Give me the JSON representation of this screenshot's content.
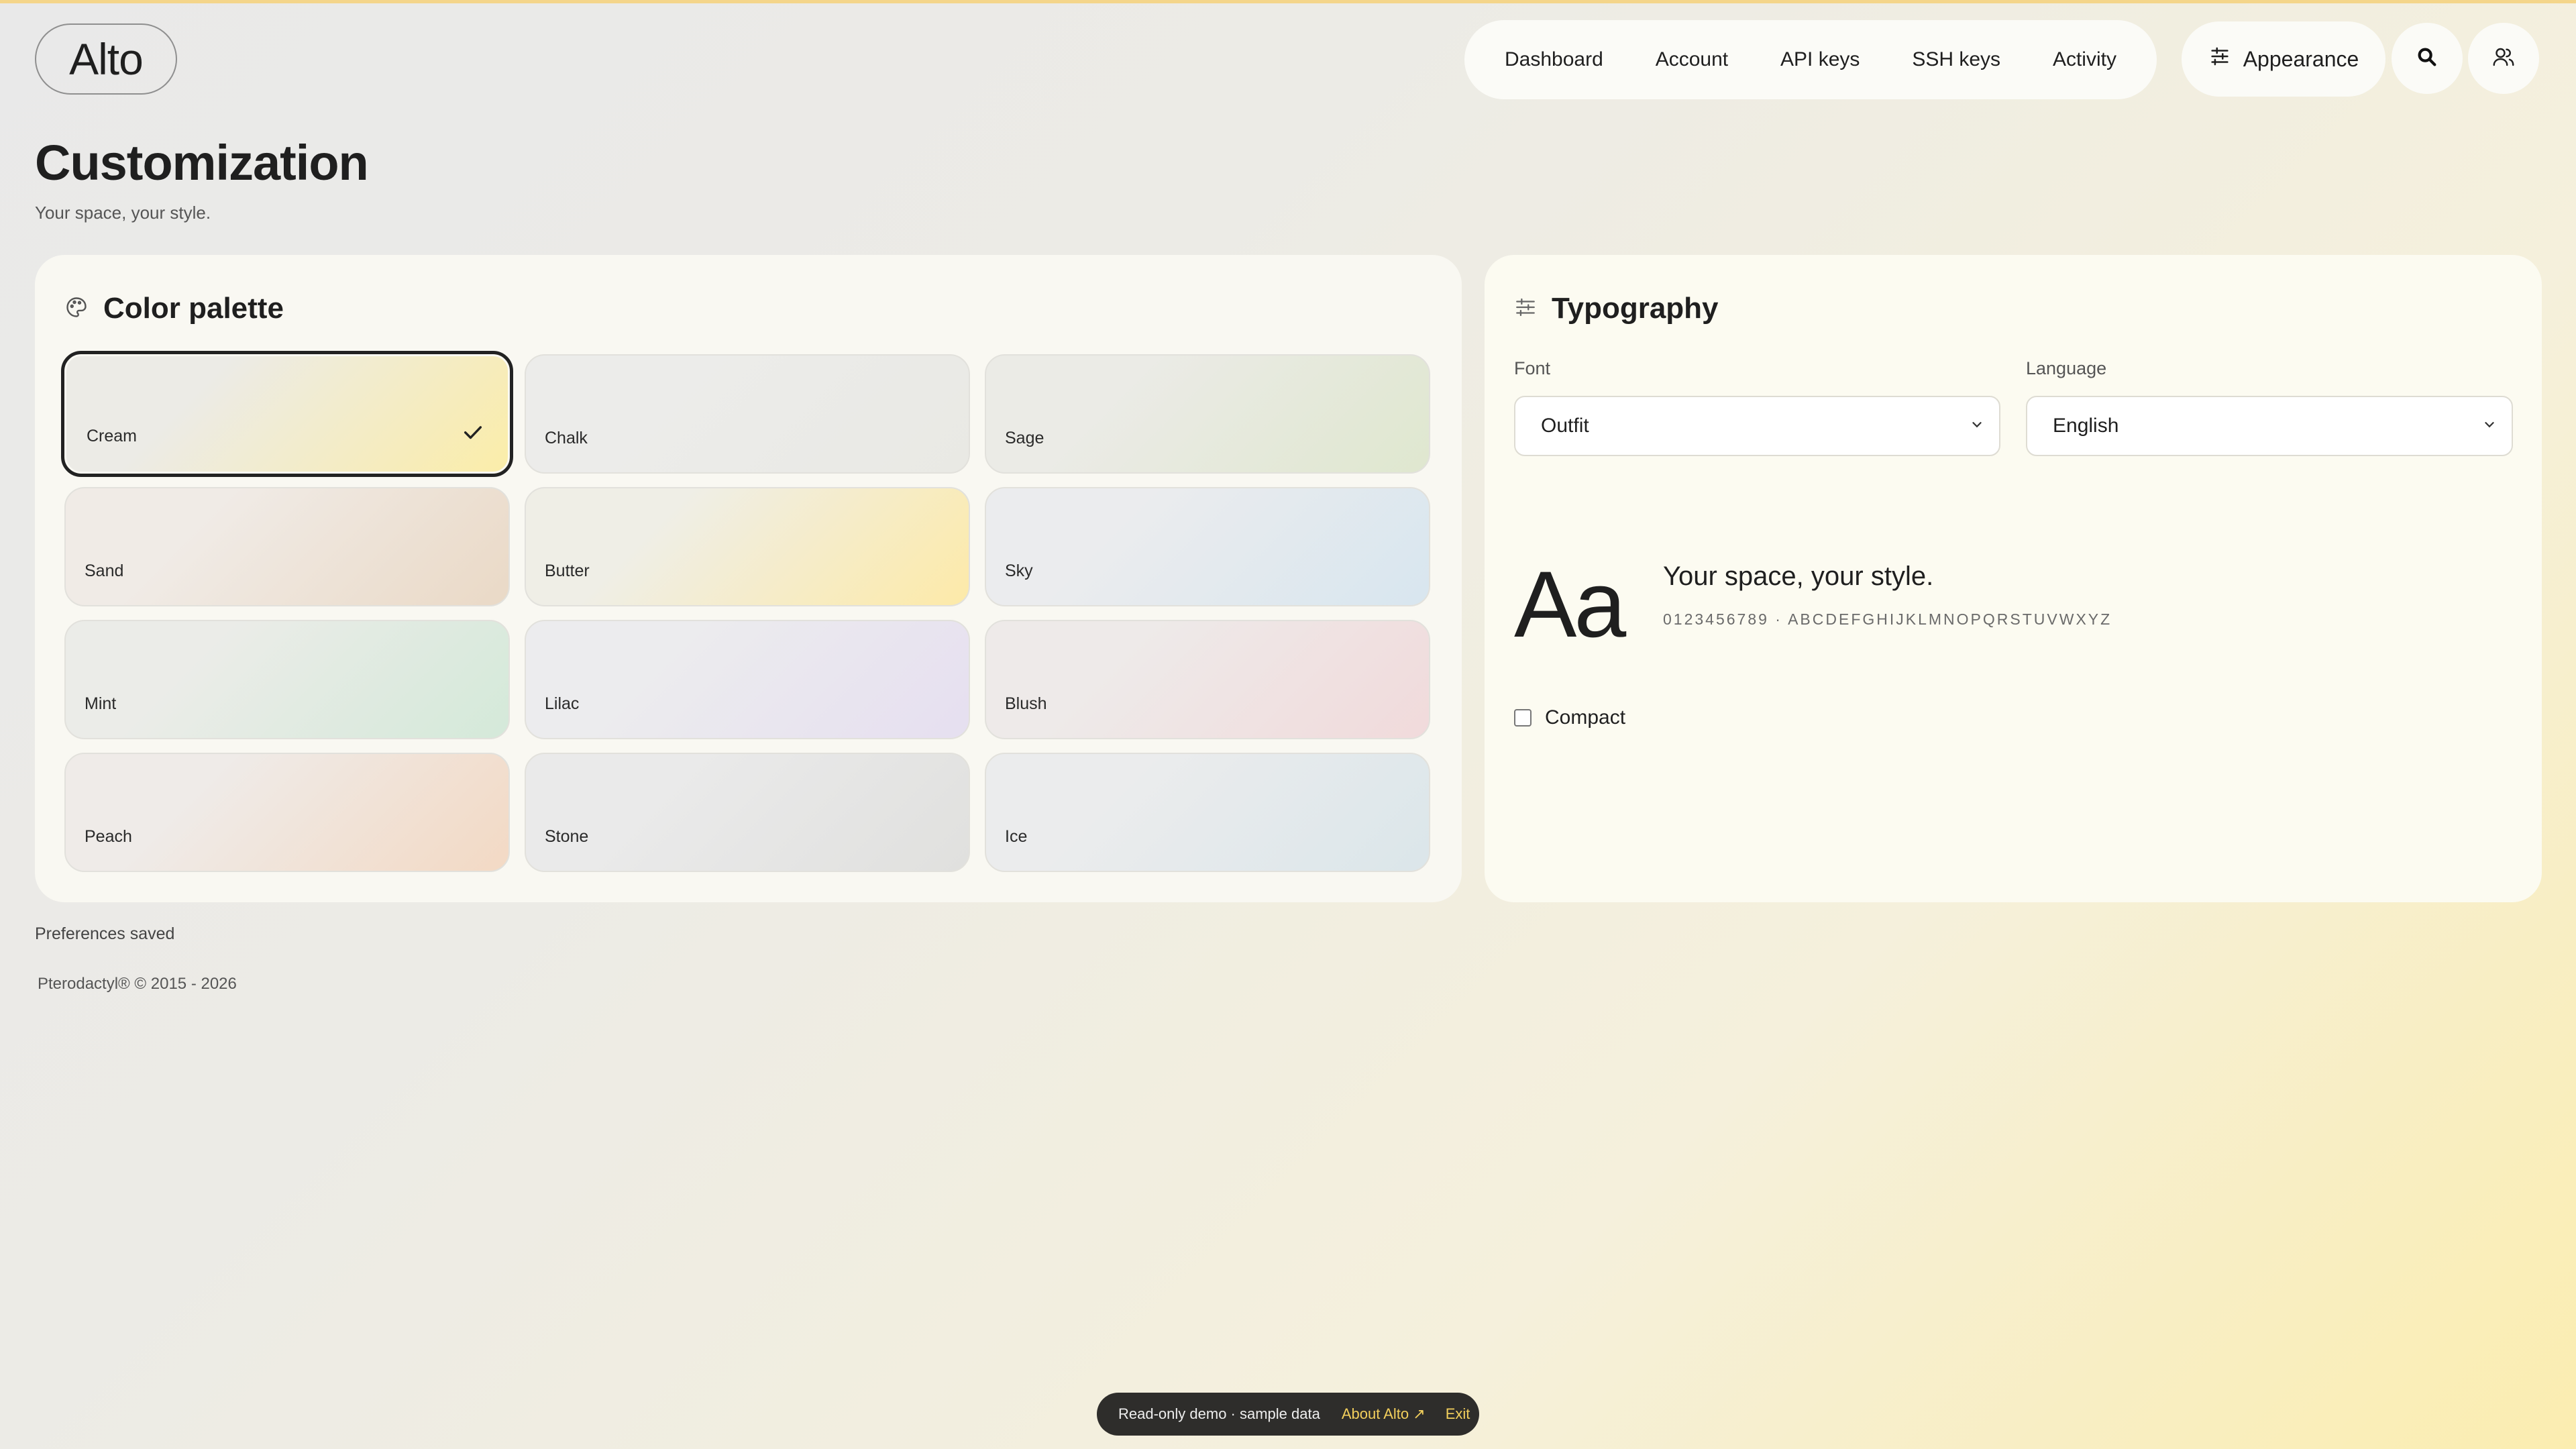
{
  "app": {
    "logo": "Alto"
  },
  "nav": {
    "items": [
      "Dashboard",
      "Account",
      "API keys",
      "SSH keys",
      "Activity"
    ],
    "appearance_label": "Appearance"
  },
  "page": {
    "title": "Customization",
    "subtitle": "Your space, your style."
  },
  "palette": {
    "title": "Color palette",
    "swatches": [
      {
        "label": "Cream",
        "selected": true,
        "from": "#ecebe6",
        "to": "#fbeda8"
      },
      {
        "label": "Chalk",
        "selected": false,
        "from": "#ececea",
        "to": "#e9e9e4"
      },
      {
        "label": "Sage",
        "selected": false,
        "from": "#ebebe6",
        "to": "#dfe7cf"
      },
      {
        "label": "Sand",
        "selected": false,
        "from": "#f0ebe6",
        "to": "#ead9c6"
      },
      {
        "label": "Butter",
        "selected": false,
        "from": "#efeee6",
        "to": "#fdeaa8"
      },
      {
        "label": "Sky",
        "selected": false,
        "from": "#ebecee",
        "to": "#d8e6ef"
      },
      {
        "label": "Mint",
        "selected": false,
        "from": "#ebece8",
        "to": "#d4e9d9"
      },
      {
        "label": "Lilac",
        "selected": false,
        "from": "#ececee",
        "to": "#e6dff0"
      },
      {
        "label": "Blush",
        "selected": false,
        "from": "#eeeae9",
        "to": "#f1dadb"
      },
      {
        "label": "Peach",
        "selected": false,
        "from": "#efebe8",
        "to": "#f3d9c4"
      },
      {
        "label": "Stone",
        "selected": false,
        "from": "#eaeaea",
        "to": "#e0e0de"
      },
      {
        "label": "Ice",
        "selected": false,
        "from": "#ebeced",
        "to": "#dbe6ea"
      }
    ]
  },
  "typography": {
    "title": "Typography",
    "font_label": "Font",
    "font_value": "Outfit",
    "language_label": "Language",
    "language_value": "English",
    "preview_aa": "Aa",
    "preview_text": "Your space, your style.",
    "preview_chars": "0123456789 · ABCDEFGHIJKLMNOPQRSTUVWXYZ",
    "compact_label": "Compact",
    "compact_checked": false
  },
  "status": "Preferences saved",
  "footer": "Pterodactyl® © 2015 - 2026",
  "demo_bar": {
    "text": "Read-only demo · sample data",
    "link": "About Alto ↗",
    "exit": "Exit"
  },
  "colors": {
    "accent": "#f2cf5c",
    "card": "#f9f8f2",
    "text": "#1f1f1f"
  }
}
